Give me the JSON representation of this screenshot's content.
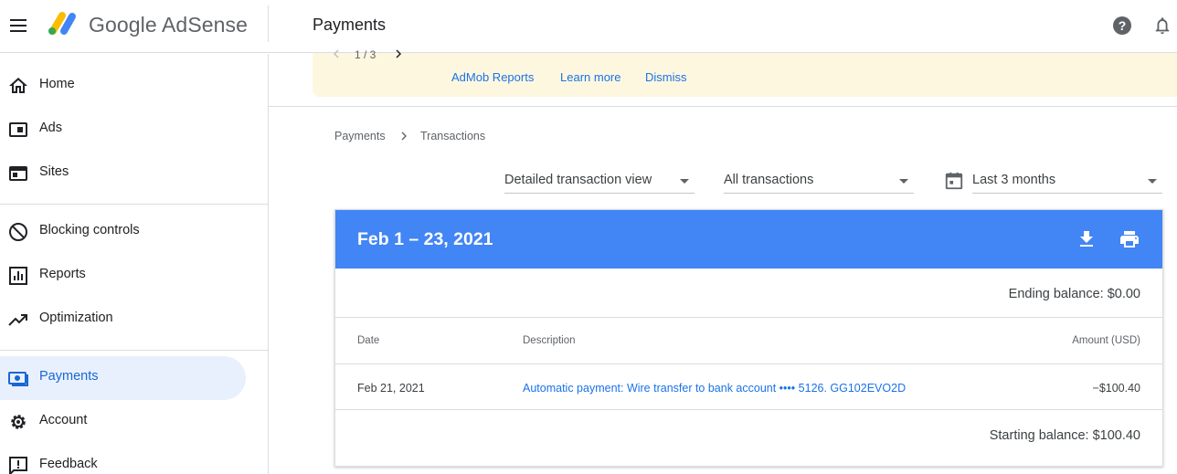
{
  "app": {
    "logo_text": "Google AdSense",
    "page_title": "Payments"
  },
  "sidebar": {
    "items": [
      {
        "label": "Home",
        "icon": "home-icon"
      },
      {
        "label": "Ads",
        "icon": "ads-icon"
      },
      {
        "label": "Sites",
        "icon": "sites-icon"
      },
      {
        "label": "Blocking controls",
        "icon": "block-icon"
      },
      {
        "label": "Reports",
        "icon": "reports-icon"
      },
      {
        "label": "Optimization",
        "icon": "trending-icon"
      },
      {
        "label": "Payments",
        "icon": "payments-icon",
        "active": true
      },
      {
        "label": "Account",
        "icon": "gear-icon"
      },
      {
        "label": "Feedback",
        "icon": "feedback-icon"
      }
    ]
  },
  "banner": {
    "pager": "1 / 3",
    "links": [
      "AdMob Reports",
      "Learn more",
      "Dismiss"
    ]
  },
  "breadcrumb": [
    "Payments",
    "Transactions"
  ],
  "filters": {
    "view": "Detailed transaction view",
    "type": "All transactions",
    "range": "Last 3 months"
  },
  "card": {
    "title": "Feb 1 – 23, 2021",
    "ending_balance": "Ending balance: $0.00",
    "columns": [
      "Date",
      "Description",
      "Amount (USD)"
    ],
    "rows": [
      {
        "date": "Feb 21, 2021",
        "description": "Automatic payment: Wire transfer to bank account •••• 5126. GG102EVO2D",
        "amount": "−$100.40"
      }
    ],
    "starting_balance": "Starting balance: $100.40"
  },
  "colors": {
    "accent": "#1a73e8",
    "header_blue": "#4285f4",
    "active_nav_bg": "#e8f0fe",
    "banner_bg": "#fef7e0"
  }
}
